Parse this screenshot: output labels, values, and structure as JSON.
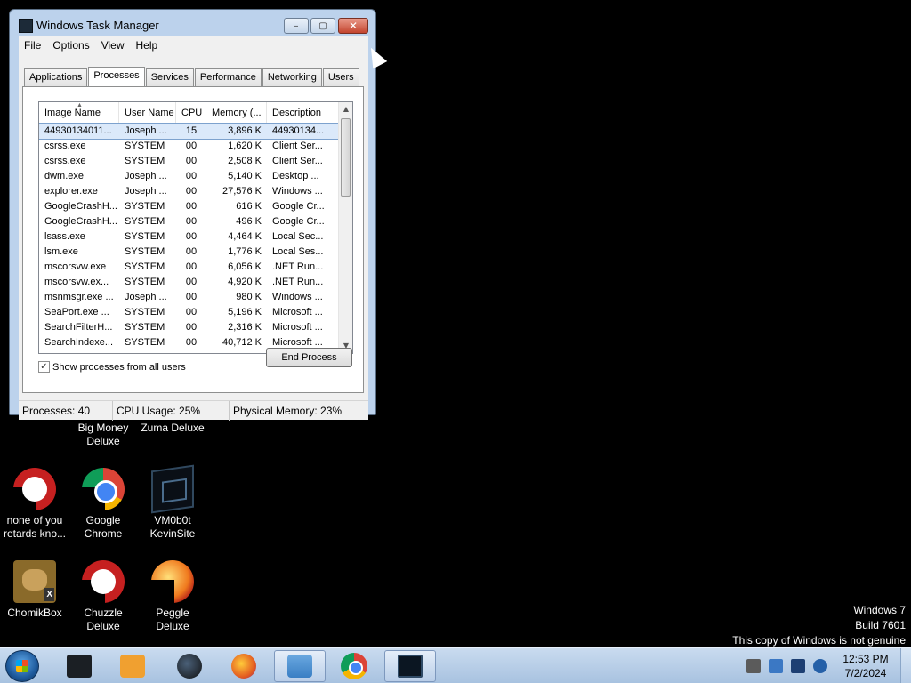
{
  "window": {
    "title": "Windows Task Manager",
    "controls": {
      "minimize": "–",
      "maximize": "▢",
      "close": "✕"
    }
  },
  "menu": [
    "File",
    "Options",
    "View",
    "Help"
  ],
  "tabs": [
    "Applications",
    "Processes",
    "Services",
    "Performance",
    "Networking",
    "Users"
  ],
  "active_tab": "Processes",
  "processes": {
    "columns": [
      "Image Name",
      "User Name",
      "CPU",
      "Memory (...",
      "Description"
    ],
    "rows": [
      {
        "name": "44930134011...",
        "user": "Joseph ...",
        "cpu": "15",
        "mem": "3,896 K",
        "desc": "44930134...",
        "selected": true
      },
      {
        "name": "csrss.exe",
        "user": "SYSTEM",
        "cpu": "00",
        "mem": "1,620 K",
        "desc": "Client Ser..."
      },
      {
        "name": "csrss.exe",
        "user": "SYSTEM",
        "cpu": "00",
        "mem": "2,508 K",
        "desc": "Client Ser..."
      },
      {
        "name": "dwm.exe",
        "user": "Joseph ...",
        "cpu": "00",
        "mem": "5,140 K",
        "desc": "Desktop ..."
      },
      {
        "name": "explorer.exe",
        "user": "Joseph ...",
        "cpu": "00",
        "mem": "27,576 K",
        "desc": "Windows ..."
      },
      {
        "name": "GoogleCrashH...",
        "user": "SYSTEM",
        "cpu": "00",
        "mem": "616 K",
        "desc": "Google Cr..."
      },
      {
        "name": "GoogleCrashH...",
        "user": "SYSTEM",
        "cpu": "00",
        "mem": "496 K",
        "desc": "Google Cr..."
      },
      {
        "name": "lsass.exe",
        "user": "SYSTEM",
        "cpu": "00",
        "mem": "4,464 K",
        "desc": "Local Sec..."
      },
      {
        "name": "lsm.exe",
        "user": "SYSTEM",
        "cpu": "00",
        "mem": "1,776 K",
        "desc": "Local Ses..."
      },
      {
        "name": "mscorsvw.exe",
        "user": "SYSTEM",
        "cpu": "00",
        "mem": "6,056 K",
        "desc": ".NET Run..."
      },
      {
        "name": "mscorsvw.ex...",
        "user": "SYSTEM",
        "cpu": "00",
        "mem": "4,920 K",
        "desc": ".NET Run..."
      },
      {
        "name": "msnmsgr.exe ...",
        "user": "Joseph ...",
        "cpu": "00",
        "mem": "980 K",
        "desc": "Windows ..."
      },
      {
        "name": "SeaPort.exe ...",
        "user": "SYSTEM",
        "cpu": "00",
        "mem": "5,196 K",
        "desc": "Microsoft ..."
      },
      {
        "name": "SearchFilterH...",
        "user": "SYSTEM",
        "cpu": "00",
        "mem": "2,316 K",
        "desc": "Microsoft ..."
      },
      {
        "name": "SearchIndexe...",
        "user": "SYSTEM",
        "cpu": "00",
        "mem": "40,712 K",
        "desc": "Microsoft ..."
      }
    ]
  },
  "show_all_users": {
    "label": "Show processes from all users",
    "checked": true
  },
  "end_process_label": "End Process",
  "status": {
    "processes": "Processes: 40",
    "cpu": "CPU Usage: 25%",
    "memory": "Physical Memory: 23%"
  },
  "desktop_icons": [
    {
      "label": "Big Money Deluxe",
      "icon": "game-icon"
    },
    {
      "label": "Zuma Deluxe",
      "icon": "game-icon"
    },
    {
      "label": "none of you retards kno...",
      "icon": "red-circle-icon"
    },
    {
      "label": "Google Chrome",
      "icon": "chrome-icon"
    },
    {
      "label": "VM0b0t KevinSite",
      "icon": "monitor-icon"
    },
    {
      "label": "ChomikBox",
      "icon": "bear-icon"
    },
    {
      "label": "Chuzzle Deluxe",
      "icon": "red-circle-icon"
    },
    {
      "label": "Peggle Deluxe",
      "icon": "peggle-icon"
    }
  ],
  "watermark": {
    "line1": "Windows 7",
    "line2": "Build 7601",
    "line3": "This copy of Windows is not genuine"
  },
  "taskbar": {
    "apps": [
      "dark-window-icon",
      "media-player-icon",
      "ball-icon",
      "firefox-icon",
      "users-icon",
      "chrome-icon",
      "task-manager-icon"
    ],
    "active_apps": [
      "users-icon",
      "task-manager-icon"
    ]
  },
  "clock": {
    "time": "12:53 PM",
    "date": "7/2/2024"
  }
}
